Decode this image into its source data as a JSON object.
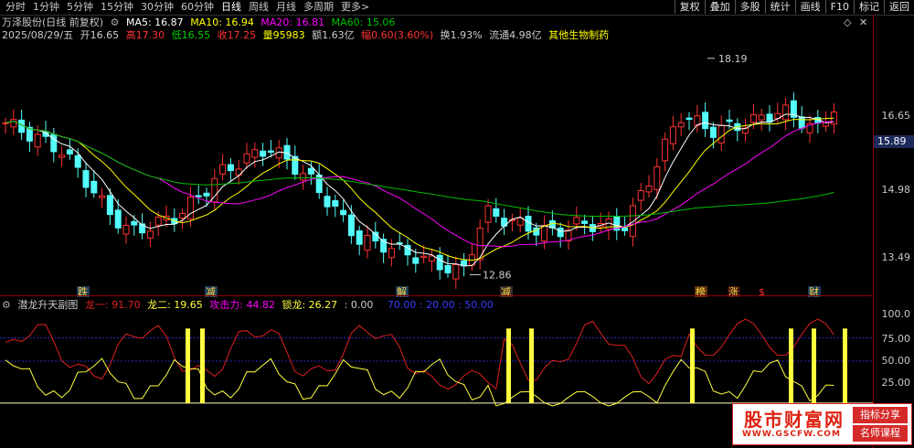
{
  "toolbar": {
    "periods": [
      "分时",
      "1分钟",
      "5分钟",
      "15分钟",
      "30分钟",
      "60分钟",
      "日线",
      "周线",
      "月线",
      "多周期",
      "更多>"
    ],
    "active_period": "日线",
    "tools": [
      "复权",
      "叠加",
      "多股",
      "统计",
      "画线",
      "F10",
      "标记",
      "返回"
    ]
  },
  "info": {
    "stock_name": "万泽股份(日线 前复权)",
    "ma5": "MA5: 16.87",
    "ma10": "MA10: 16.94",
    "ma20": "MA20: 16.81",
    "ma60": "MA60: 15.06",
    "date": "2025/08/29/五",
    "open": "开16.65",
    "high": "高17.30",
    "low": "低16.55",
    "close": "收17.25",
    "volume": "量95983",
    "amount": "额1.63亿",
    "change": "幅0.60(3.60%)",
    "turnover": "换1.93%",
    "float": "流通4.98亿",
    "sector": "其他生物制药"
  },
  "axis": {
    "main": [
      "16.65",
      "14.98",
      "13.49"
    ],
    "current_price": "15.89",
    "sub": [
      "100.0",
      "75.00",
      "50.00",
      "25.00"
    ]
  },
  "annotations": {
    "high_label": "18.19",
    "low_label": "12.86",
    "markers": [
      "跌",
      "减",
      "解",
      "减",
      "榜",
      "涨",
      "$",
      "财"
    ]
  },
  "indicator": {
    "name": "潜龙升天副图",
    "line1": "龙一: 91.70",
    "line2": "龙二: 19.65",
    "attack": "攻击力: 44.82",
    "lock": "锁龙: 26.27",
    "zero": ": 0.00",
    "levels": "70.00 : 20.00 : 50.00"
  },
  "logo": {
    "name": "股市财富网",
    "url": "WWW.GSCFW.COM",
    "btn1": "指标分享",
    "btn2": "名师课程"
  },
  "colors": {
    "up": "#ff3232",
    "down": "#54fcfc",
    "ma5": "#ffffff",
    "ma10": "#ffff00",
    "ma20": "#ff00ff",
    "ma60": "#00c000",
    "indicator_red": "#e02020",
    "indicator_yellow": "#ffff40"
  }
}
